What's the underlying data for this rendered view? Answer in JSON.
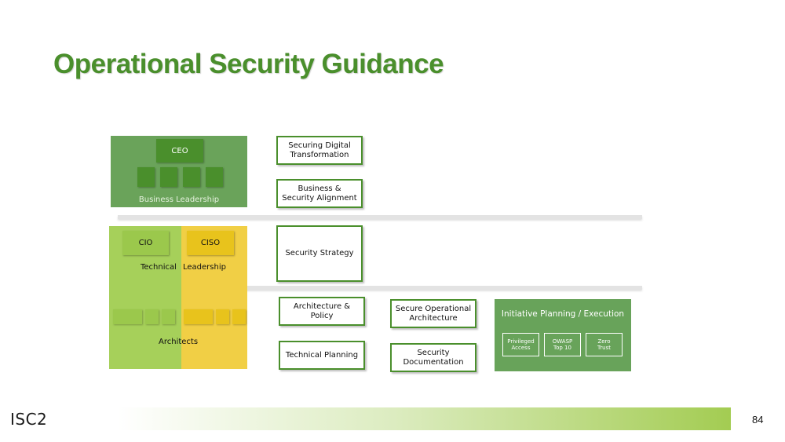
{
  "slide": {
    "title": "Operational Security Guidance",
    "page_number": "84",
    "logo_text": "ISC2"
  },
  "org_chart": {
    "ceo_label": "CEO",
    "business_leadership_label": "Business Leadership",
    "cio_label": "CIO",
    "ciso_label": "CISO",
    "technical_label": "Technical",
    "leadership_label": "Leadership",
    "architects_label": "Architects"
  },
  "boxes": {
    "securing_digital_transformation": "Securing Digital Transformation",
    "business_security_alignment": "Business & Security Alignment",
    "security_strategy": "Security Strategy",
    "architecture_policy": "Architecture & Policy",
    "technical_planning": "Technical Planning",
    "secure_operational_architecture": "Secure Operational Architecture",
    "security_documentation": "Security Documentation"
  },
  "initiative": {
    "title": "Initiative Planning / Execution",
    "items": [
      "Privileged Access",
      "OWASP Top 10",
      "Zero Trust"
    ]
  },
  "colors": {
    "title_green": "#4a8f2c",
    "business_green": "#6aa35a",
    "dark_green": "#4a8f2c",
    "light_green": "#a6d05a",
    "yellow": "#f1cf45",
    "initiative_green": "#68a35a"
  }
}
